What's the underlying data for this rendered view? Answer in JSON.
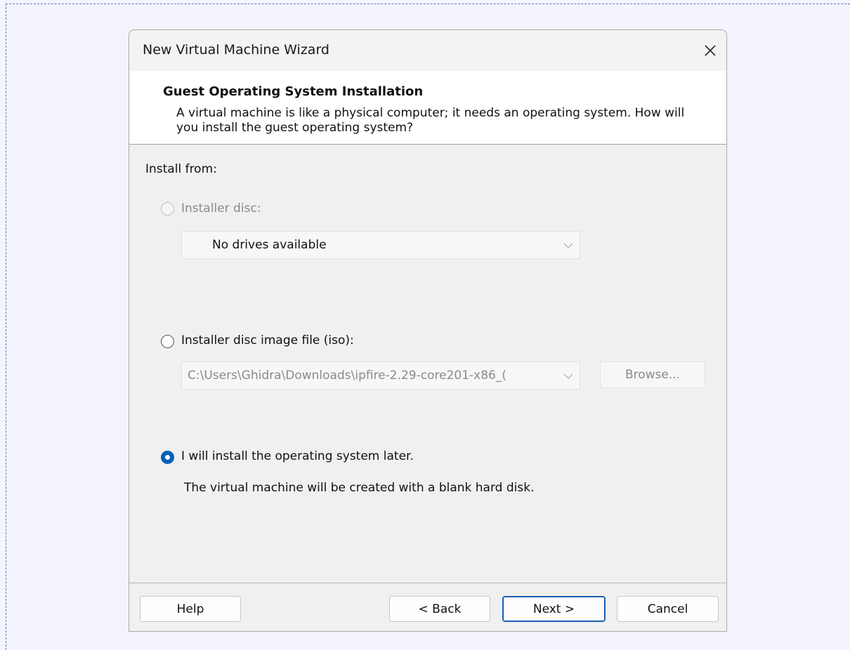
{
  "window": {
    "title": "New Virtual Machine Wizard",
    "close_icon": "close-icon"
  },
  "header": {
    "title": "Guest Operating System Installation",
    "description": "A virtual machine is like a physical computer; it needs an operating system. How will you install the guest operating system?"
  },
  "install_from": {
    "label": "Install from:",
    "options": [
      {
        "label": "Installer disc:",
        "selected": false,
        "enabled": false
      },
      {
        "label": "Installer disc image file (iso):",
        "selected": false,
        "enabled": true
      },
      {
        "label": "I will install the operating system later.",
        "selected": true,
        "enabled": true
      }
    ],
    "disc_dropdown": {
      "value": "No drives available"
    },
    "iso_path": {
      "value": "C:\\Users\\Ghidra\\Downloads\\ipfire-2.29-core201-x86_("
    },
    "browse_label": "Browse...",
    "later_note": "The virtual machine will be created with a blank hard disk."
  },
  "footer": {
    "help": "Help",
    "back": "< Back",
    "next": "Next >",
    "cancel": "Cancel"
  },
  "colors": {
    "accent": "#005fb8",
    "page_bg": "#f3f4fd",
    "dialog_bg": "#f0f0f0"
  }
}
